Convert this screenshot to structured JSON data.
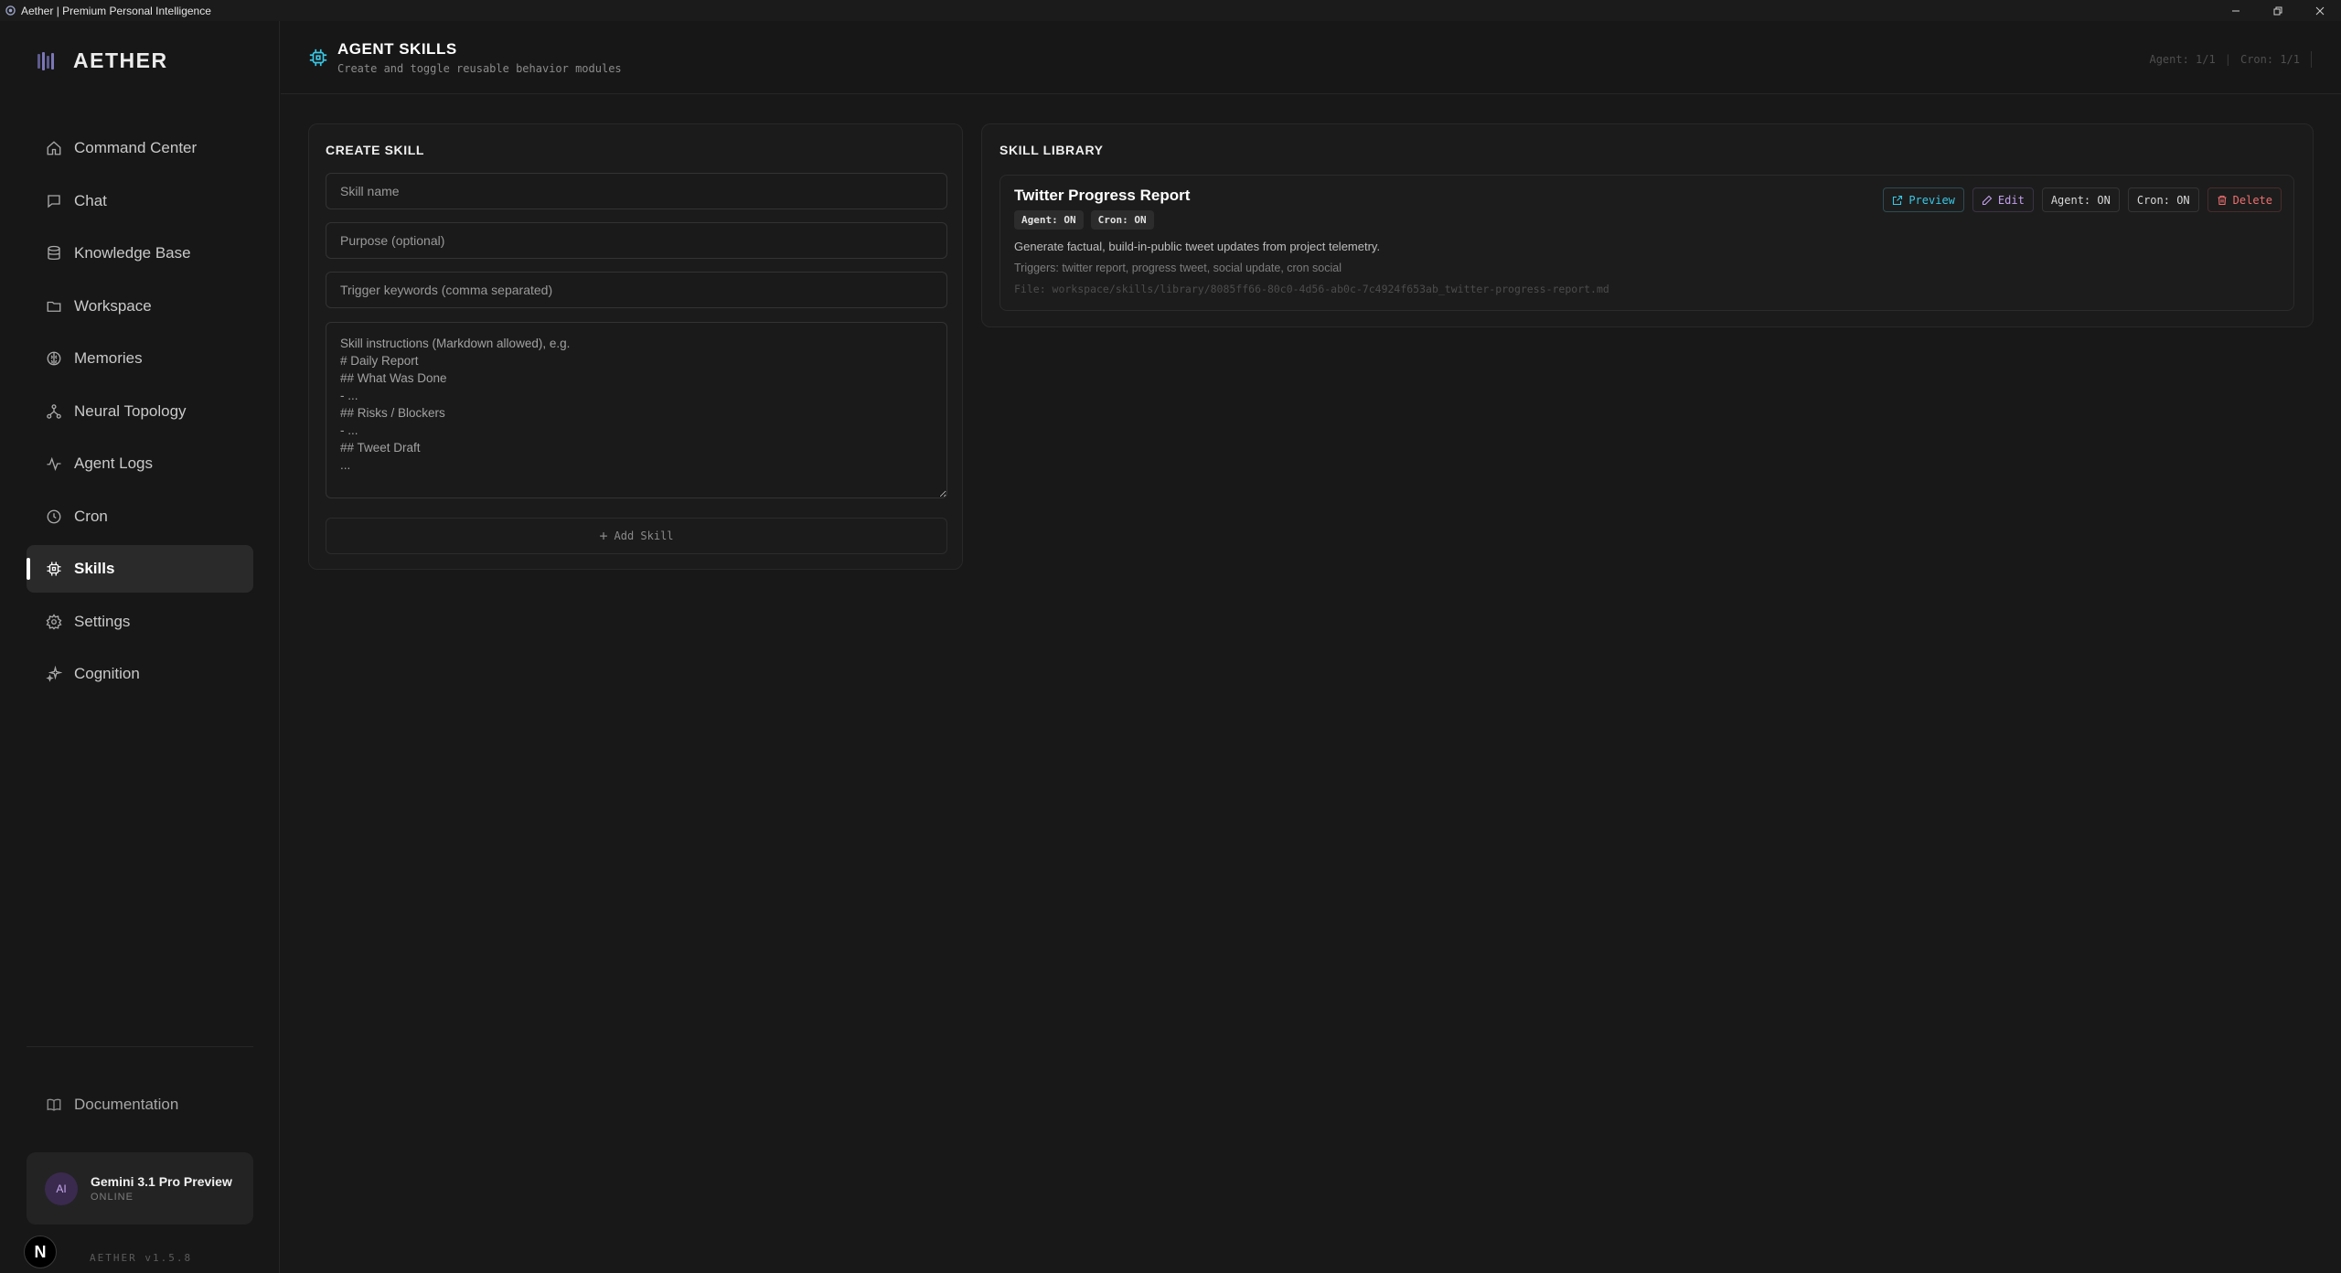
{
  "window": {
    "title": "Aether | Premium Personal Intelligence"
  },
  "sidebar": {
    "brand": "AETHER",
    "items": [
      {
        "label": "Command Center",
        "icon": "home-icon"
      },
      {
        "label": "Chat",
        "icon": "chat-icon"
      },
      {
        "label": "Knowledge Base",
        "icon": "database-icon"
      },
      {
        "label": "Workspace",
        "icon": "folder-icon"
      },
      {
        "label": "Memories",
        "icon": "brain-icon"
      },
      {
        "label": "Neural Topology",
        "icon": "network-icon"
      },
      {
        "label": "Agent Logs",
        "icon": "activity-icon"
      },
      {
        "label": "Cron",
        "icon": "clock-icon"
      },
      {
        "label": "Skills",
        "icon": "cpu-icon",
        "active": true
      },
      {
        "label": "Settings",
        "icon": "gear-icon"
      },
      {
        "label": "Cognition",
        "icon": "sparkles-icon"
      }
    ],
    "documentation": "Documentation",
    "model": {
      "avatar": "AI",
      "name": "Gemini 3.1 Pro Preview",
      "status": "ONLINE"
    },
    "n_badge": "N",
    "version": "AETHER v1.5.8"
  },
  "header": {
    "title": "AGENT SKILLS",
    "subtitle": "Create and toggle reusable behavior modules",
    "agent_stat": "Agent: 1/1",
    "cron_stat": "Cron: 1/1"
  },
  "create": {
    "title": "CREATE SKILL",
    "name_placeholder": "Skill name",
    "purpose_placeholder": "Purpose (optional)",
    "triggers_placeholder": "Trigger keywords (comma separated)",
    "instructions_placeholder": "Skill instructions (Markdown allowed), e.g.\n# Daily Report\n## What Was Done\n- ...\n## Risks / Blockers\n- ...\n## Tweet Draft\n...",
    "add_label": "Add Skill"
  },
  "library": {
    "title": "SKILL LIBRARY",
    "skills": [
      {
        "name": "Twitter Progress Report",
        "tags": [
          "Agent: ON",
          "Cron: ON"
        ],
        "description": "Generate factual, build-in-public tweet updates from project telemetry.",
        "triggers": "Triggers: twitter report, progress tweet, social update, cron social",
        "file": "File: workspace/skills/library/8085ff66-80c0-4d56-ab0c-7c4924f653ab_twitter-progress-report.md",
        "actions": {
          "preview": "Preview",
          "edit": "Edit",
          "agent": "Agent: ON",
          "cron": "Cron: ON",
          "delete": "Delete"
        }
      }
    ]
  },
  "colors": {
    "accent_cyan": "#39c7e5",
    "accent_purple": "#c3a0ee",
    "danger_red": "#ef6f6f"
  }
}
